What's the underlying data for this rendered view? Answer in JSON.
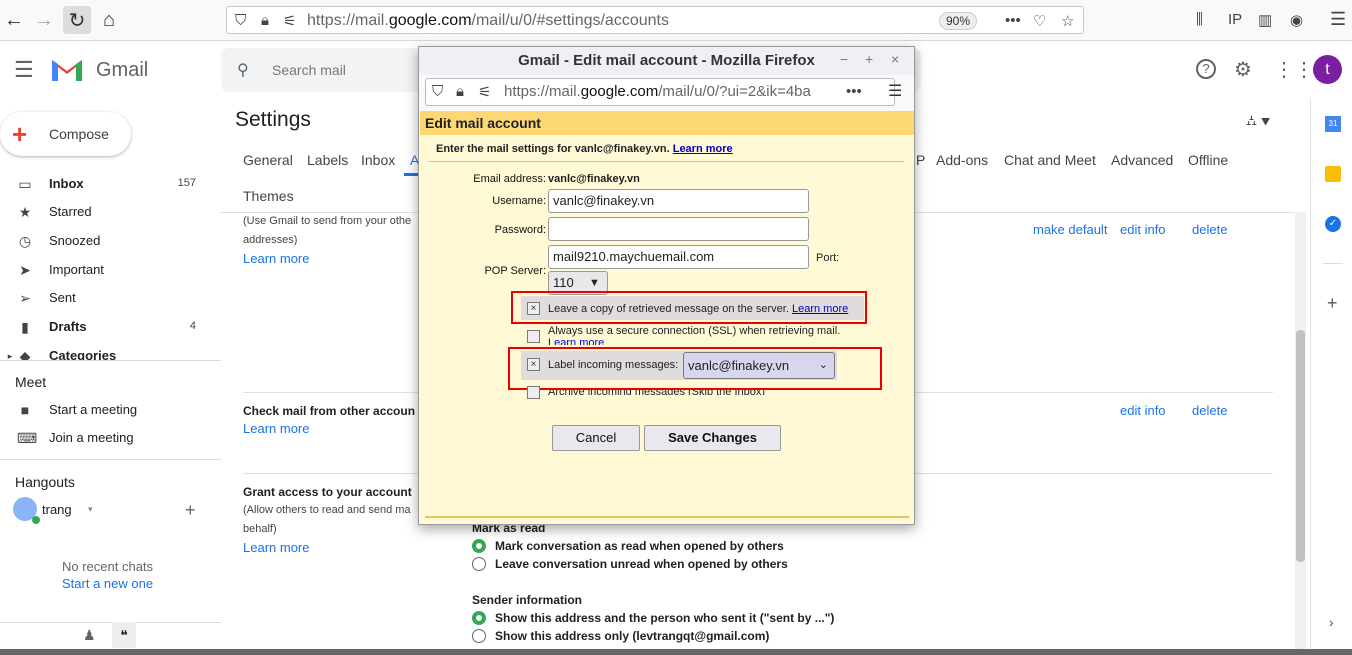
{
  "browser": {
    "url_prefix": "https://mail.",
    "url_domain": "google.com",
    "url_suffix": "/mail/u/0/#settings/accounts",
    "zoom": "90%"
  },
  "gmail": {
    "logo_text": "Gmail",
    "search_placeholder": "Search mail",
    "avatar_letter": "t",
    "page_title": "Settings"
  },
  "sidebar": {
    "compose": "Compose",
    "items": [
      {
        "label": "Inbox",
        "count": "157",
        "icon": "inbox-icon"
      },
      {
        "label": "Starred",
        "count": "",
        "icon": "star-icon"
      },
      {
        "label": "Snoozed",
        "count": "",
        "icon": "clock-icon"
      },
      {
        "label": "Important",
        "count": "",
        "icon": "important-icon"
      },
      {
        "label": "Sent",
        "count": "",
        "icon": "send-icon"
      },
      {
        "label": "Drafts",
        "count": "4",
        "icon": "file-icon"
      },
      {
        "label": "Categories",
        "count": "",
        "icon": "tag-icon"
      }
    ],
    "meet_title": "Meet",
    "meet_items": [
      "Start a meeting",
      "Join a meeting"
    ],
    "hangouts_title": "Hangouts",
    "hangouts_user": "trang",
    "no_chats": "No recent chats",
    "start_new": "Start a new one"
  },
  "tabs": [
    "General",
    "Labels",
    "Inbox",
    "A",
    "P",
    "Add-ons",
    "Chat and Meet",
    "Advanced",
    "Offline",
    "Themes"
  ],
  "settings": {
    "send_desc1": "(Use Gmail to send from your othe",
    "send_desc2": "addresses)",
    "learn_more": "Learn more",
    "make_default": "make default",
    "edit_info": "edit info",
    "delete": "delete",
    "check_mail_title": "Check mail from other accoun",
    "grant_title": "Grant access to your account",
    "grant_desc1": "(Allow others to read and send ma",
    "grant_desc2": "behalf)",
    "mark_read_title": "Mark as read",
    "mark_read_opt1": "Mark conversation as read when opened by others",
    "mark_read_opt2": "Leave conversation unread when opened by others",
    "sender_info_title": "Sender information",
    "sender_opt1": "Show this address and the person who sent it (\"sent by ...\")",
    "sender_opt2": "Show this address only (levtrangqt@gmail.com)"
  },
  "dialog": {
    "window_title": "Gmail - Edit mail account - Mozilla Firefox",
    "url_prefix": "https://mail.",
    "url_domain": "google.com",
    "url_suffix": "/mail/u/0/?ui=2&ik=4ba",
    "header": "Edit mail account",
    "intro": "Enter the mail settings for vanlc@finakey.vn.",
    "intro_link": "Learn more",
    "email_label": "Email address:",
    "email_value": "vanlc@finakey.vn",
    "username_label": "Username:",
    "username_value": "vanlc@finakey.vn",
    "password_label": "Password:",
    "pop_label": "POP Server:",
    "pop_value": "mail9210.maychuemail.com",
    "port_label": "Port:",
    "port_value": "110",
    "leave_copy": "Leave a copy of retrieved message on the server.",
    "leave_copy_link": "Learn more",
    "ssl": "Always use a secure connection (SSL) when retrieving mail.",
    "ssl_link": "Learn more",
    "label_incoming": "Label incoming messages:",
    "label_value": "vanlc@finakey.vn",
    "archive": "Archive incoming messages (Skip the Inbox)",
    "cancel": "Cancel",
    "save": "Save Changes"
  }
}
